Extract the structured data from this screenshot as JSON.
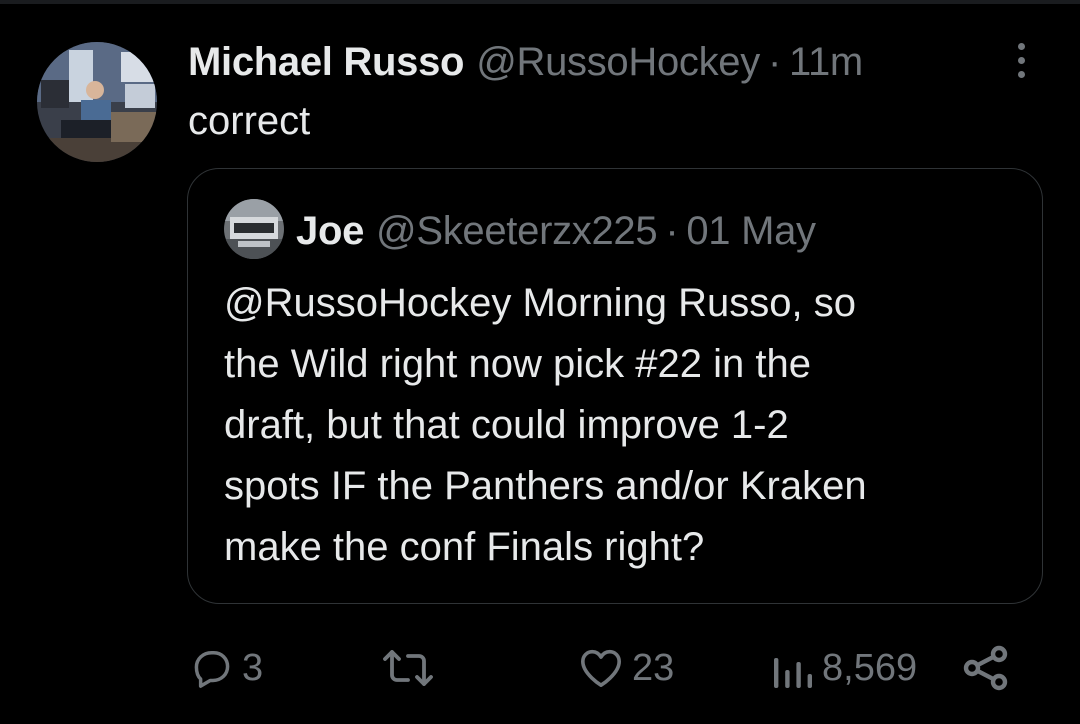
{
  "tweet": {
    "author": {
      "display_name": "Michael Russo",
      "handle": "@RussoHockey",
      "separator": "·",
      "time": "11m"
    },
    "text": "correct",
    "quoted": {
      "author": {
        "display_name": "Joe",
        "handle": "@Skeeterzx225",
        "separator": "·",
        "date": "01 May"
      },
      "lines": [
        "@RussoHockey Morning Russo, so",
        "the Wild right now pick #22 in the",
        "draft, but that could improve 1-2",
        "spots IF the Panthers and/or Kraken",
        "make the conf Finals right?"
      ]
    },
    "actions": {
      "replies": "3",
      "reposts": "",
      "likes": "23",
      "views": "8,569"
    },
    "icons": {
      "reply": "reply-icon",
      "repost": "repost-icon",
      "like": "heart-icon",
      "views": "views-icon",
      "share": "share-icon",
      "more": "more-icon"
    },
    "colors": {
      "background": "#000000",
      "text": "#e7e9ea",
      "muted": "#71767b",
      "border": "#2f3336"
    }
  }
}
